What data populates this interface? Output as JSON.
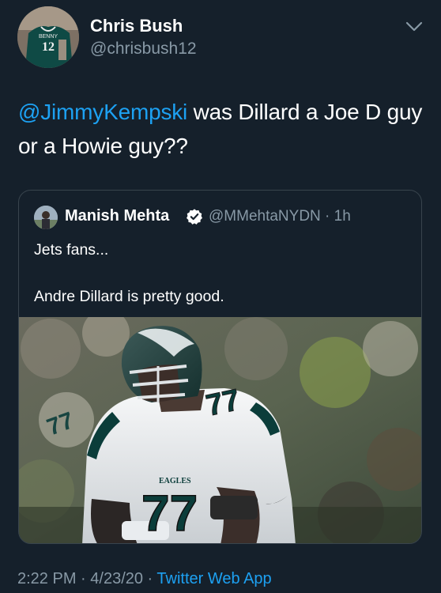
{
  "author": {
    "name": "Chris Bush",
    "handle": "@chrisbush12",
    "avatar_jersey_text": "BENNY",
    "avatar_jersey_number": "12"
  },
  "tweet": {
    "mention": "@JimmyKempski",
    "text_after_mention": " was Dillard a Joe D guy or a Howie guy??"
  },
  "quoted_tweet": {
    "author_name": "Manish Mehta",
    "author_handle": "@MMehtaNYDN",
    "separator": " · ",
    "time": "1h",
    "verified": true,
    "line1": "Jets fans...",
    "line2": "Andre Dillard is pretty good.",
    "image": {
      "jersey_number": "77",
      "team_wordmark": "EAGLES",
      "jersey_color": "#f2f4f5",
      "helmet_color": "#1f3a3a"
    }
  },
  "footer": {
    "time": "2:22 PM",
    "date": "4/23/20",
    "separator": " · ",
    "source": "Twitter Web App"
  },
  "colors": {
    "background": "#15202b",
    "link": "#1da1f2",
    "muted": "#8899a6",
    "border": "#38444d"
  },
  "icons": {
    "more": "chevron-down-icon",
    "verified": "verified-badge-icon"
  }
}
